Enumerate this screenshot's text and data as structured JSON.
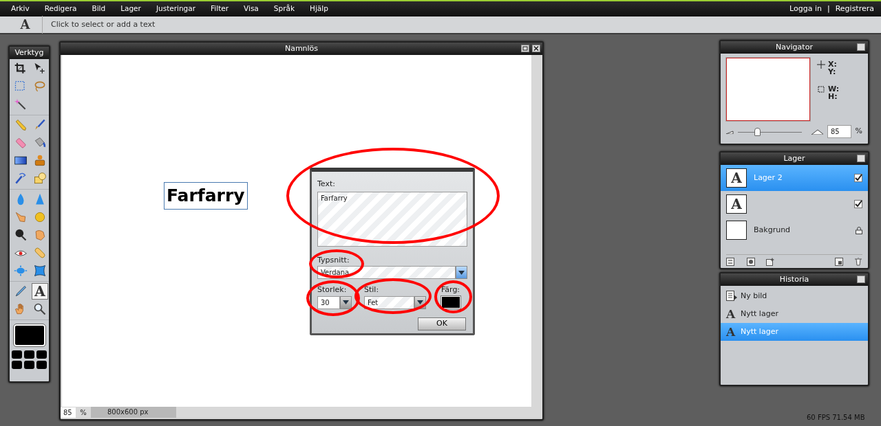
{
  "menu_bar": {
    "items": [
      "Arkiv",
      "Redigera",
      "Bild",
      "Lager",
      "Justeringar",
      "Filter",
      "Visa",
      "Språk",
      "Hjälp"
    ],
    "account_links": [
      "Logga in",
      "Registrera"
    ],
    "separator": "|"
  },
  "options_bar": {
    "tool_glyph": "A",
    "hint": "Click to select or add a text"
  },
  "tools_panel": {
    "title": "Verktyg",
    "groups": [
      {
        "tools": [
          {
            "kind": "crop",
            "selected": false
          },
          {
            "kind": "move",
            "selected": false
          },
          {
            "kind": "marquee",
            "selected": false
          },
          {
            "kind": "lasso",
            "selected": false
          },
          {
            "kind": "wand",
            "selected": false
          }
        ]
      },
      {
        "tools": [
          {
            "kind": "pencil",
            "selected": false
          },
          {
            "kind": "brush",
            "selected": false
          },
          {
            "kind": "eraser",
            "selected": false
          },
          {
            "kind": "bucket",
            "selected": false
          },
          {
            "kind": "gradient",
            "selected": false
          },
          {
            "kind": "stamp",
            "selected": false
          },
          {
            "kind": "replace",
            "selected": false
          },
          {
            "kind": "shape",
            "selected": false
          }
        ]
      },
      {
        "tools": [
          {
            "kind": "blur",
            "selected": false
          },
          {
            "kind": "sharpen",
            "selected": false
          },
          {
            "kind": "smudge",
            "selected": false
          },
          {
            "kind": "sponge",
            "selected": false
          },
          {
            "kind": "burn",
            "selected": false
          },
          {
            "kind": "dodge",
            "selected": false
          },
          {
            "kind": "redeye",
            "selected": false
          },
          {
            "kind": "heal",
            "selected": false
          },
          {
            "kind": "bloat",
            "selected": false
          },
          {
            "kind": "pinch",
            "selected": false
          }
        ]
      },
      {
        "tools": [
          {
            "kind": "picker",
            "selected": false
          },
          {
            "kind": "text",
            "glyph": "A",
            "selected": true
          },
          {
            "kind": "hand",
            "selected": false
          },
          {
            "kind": "zoom",
            "selected": false
          }
        ]
      }
    ],
    "primary_swatch": {
      "color": "#000000"
    },
    "swatches": [
      {
        "color": "#000000"
      },
      {
        "color": "#000000"
      },
      {
        "color": "#000000"
      },
      {
        "color": "#000000"
      },
      {
        "color": "#000000"
      },
      {
        "color": "#000000"
      }
    ]
  },
  "document": {
    "title": "Namnlös",
    "canvas_text": "Farfarry",
    "zoom": "85",
    "zoom_unit": "%",
    "size": "800x600 px",
    "text_dialog": {
      "text_label": "Text:",
      "text_value": "Farfarry",
      "text_circled": true,
      "font_label": "Typsnitt:",
      "font_value": "Verdana",
      "font_circled": true,
      "size_label": "Storlek:",
      "size_value": "30",
      "size_circled": true,
      "style_label": "Stil:",
      "style_value": "Fet",
      "style_circled": true,
      "color_label": "Färg:",
      "color": "#000000",
      "color_circled": true,
      "ok_button": "OK"
    }
  },
  "navigator": {
    "title": "Navigator",
    "x_label": "X:",
    "y_label": "Y:",
    "w_label": "W:",
    "h_label": "H:",
    "zoom_slider": {
      "level": 0.25
    },
    "zoom_value": "85",
    "zoom_unit": "%"
  },
  "layers": {
    "title": "Lager",
    "items": [
      {
        "name": "Lager 2",
        "thumb_glyph": "A",
        "selected": true,
        "visible": true,
        "locked": false
      },
      {
        "thumb_glyph": "A",
        "selected": false,
        "visible": true,
        "locked": false
      },
      {
        "name": "Bakgrund",
        "selected": false,
        "visible": false,
        "locked": true
      }
    ]
  },
  "history": {
    "title": "Historia",
    "items": [
      {
        "kind": "document",
        "label": "Ny bild",
        "selected": false
      },
      {
        "kind": "text",
        "glyph": "A",
        "label": "Nytt lager",
        "selected": false
      },
      {
        "kind": "text",
        "glyph": "A",
        "label": "Nytt lager",
        "selected": true
      }
    ]
  },
  "status": "60 FPS 71.54 MB"
}
